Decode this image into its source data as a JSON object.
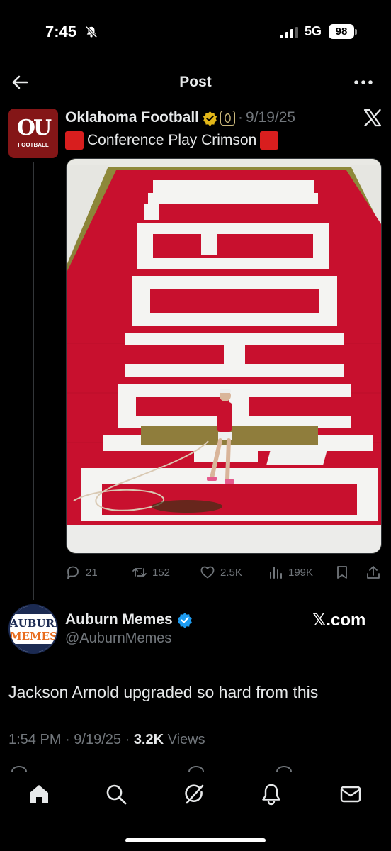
{
  "status_bar": {
    "time": "7:45",
    "network": "5G",
    "battery": "98",
    "icons": [
      "bell-slash-icon",
      "signal-icon"
    ]
  },
  "header": {
    "title": "Post",
    "icons": [
      "back-arrow-icon",
      "more-icon"
    ]
  },
  "quoted_post": {
    "avatar_text": "OU",
    "avatar_subtext": "FOOTBALL",
    "author_name": "Oklahoma Football",
    "separator": "·",
    "date": "9/19/25",
    "text": "Conference Play Crimson",
    "media_description_icons": [
      "field-photo"
    ],
    "colors": {
      "crimson": "#841617",
      "red_square": "#d81e1e",
      "field_text": "#f4f4f4",
      "turf": "#8a7a3e"
    },
    "actions": [
      {
        "icon": "reply-icon",
        "count": "21"
      },
      {
        "icon": "repost-icon",
        "count": "152"
      },
      {
        "icon": "like-icon",
        "count": "2.5K"
      },
      {
        "icon": "views-icon",
        "count": "199K"
      },
      {
        "icon": "bookmark-icon",
        "count": ""
      },
      {
        "icon": "share-icon",
        "count": ""
      }
    ],
    "field_text": "OKLAHOMA"
  },
  "main_post": {
    "author_name": "Auburn Memes",
    "handle": "@AuburnMemes",
    "source": "𝕏.com",
    "avatar_line1": "AUBURN",
    "avatar_line2": "MEMES",
    "text": "Jackson Arnold upgraded so hard from this",
    "time": "1:54 PM",
    "date": "9/19/25",
    "separator": "·",
    "views_count": "3.2K",
    "views_label": "Views"
  },
  "bottom_nav": {
    "items": [
      {
        "name": "home",
        "icon": "home-icon"
      },
      {
        "name": "search",
        "icon": "search-icon"
      },
      {
        "name": "grok",
        "icon": "grok-icon"
      },
      {
        "name": "notifications",
        "icon": "bell-icon"
      },
      {
        "name": "messages",
        "icon": "mail-icon"
      }
    ]
  },
  "theme": {
    "background": "#000000",
    "text": "#e7e9ea",
    "muted": "#71767b",
    "verified_blue": "#1d9bf0",
    "verified_gold": "#e2b719"
  }
}
